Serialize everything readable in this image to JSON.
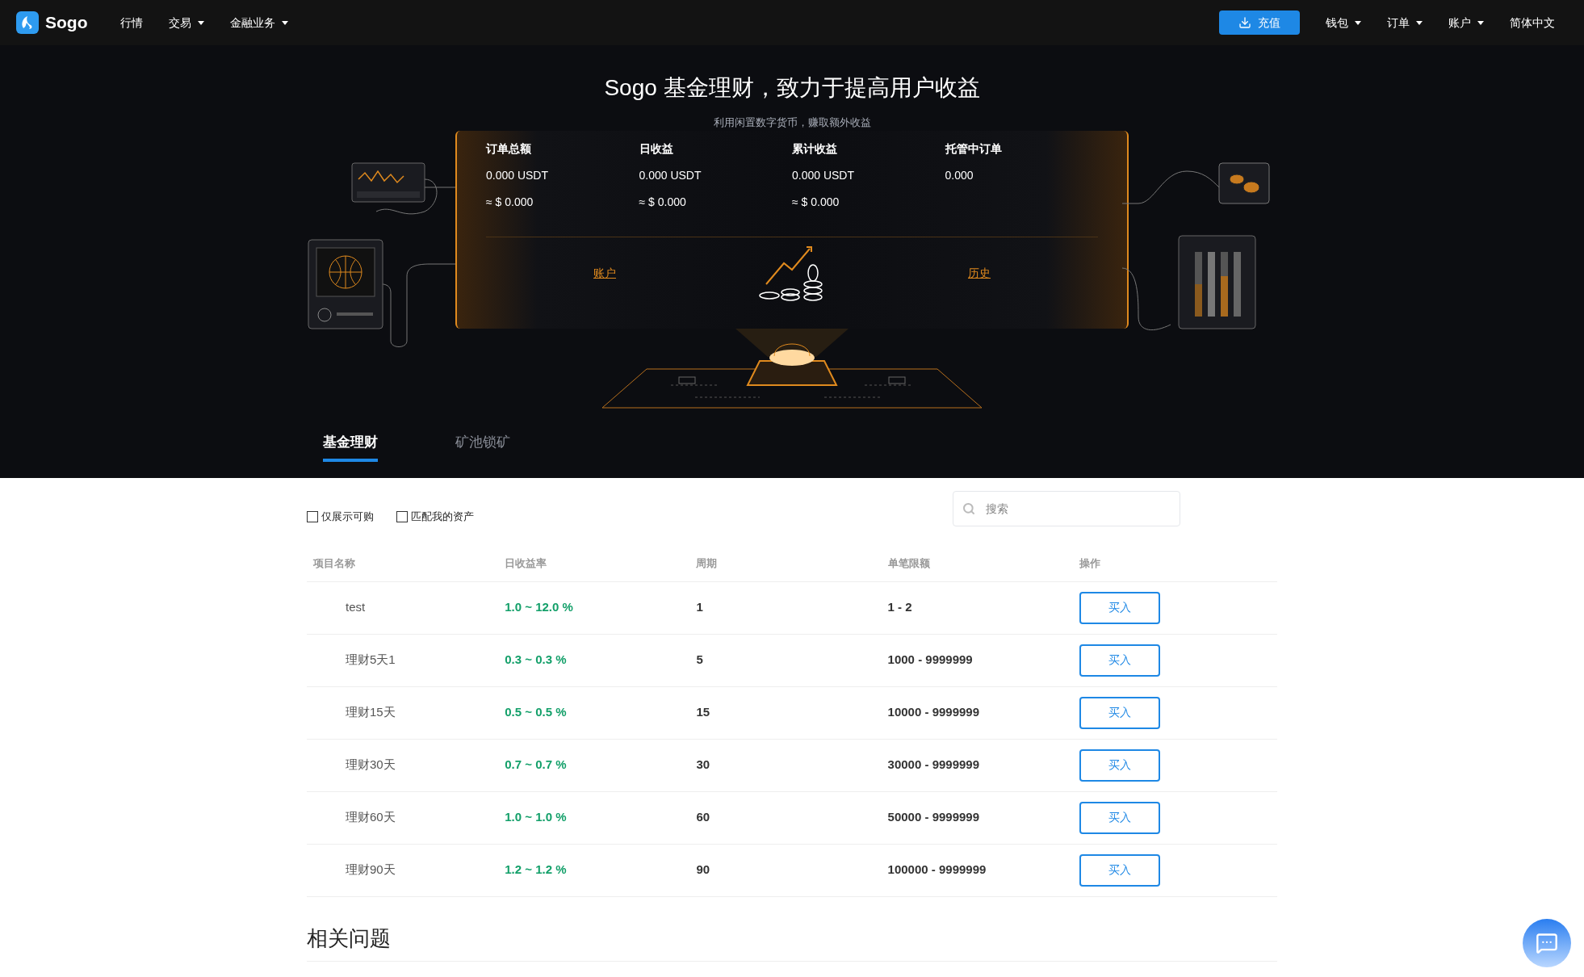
{
  "nav": {
    "brand": "Sogo",
    "items": [
      {
        "label": "行情",
        "dropdown": false
      },
      {
        "label": "交易",
        "dropdown": true
      },
      {
        "label": "金融业务",
        "dropdown": true
      }
    ],
    "deposit_button": "充值",
    "right_items": [
      {
        "label": "钱包",
        "dropdown": true
      },
      {
        "label": "订单",
        "dropdown": true
      },
      {
        "label": "账户",
        "dropdown": true
      },
      {
        "label": "简体中文",
        "dropdown": false
      }
    ]
  },
  "hero": {
    "title": "Sogo 基金理财，致力于提高用户收益",
    "subtitle": "利用闲置数字货币，赚取额外收益",
    "stats": [
      {
        "label": "订单总额",
        "value": "0.000 USDT",
        "approx": "≈ $ 0.000"
      },
      {
        "label": "日收益",
        "value": "0.000 USDT",
        "approx": "≈ $ 0.000"
      },
      {
        "label": "累计收益",
        "value": "0.000 USDT",
        "approx": "≈ $ 0.000"
      },
      {
        "label": "托管中订单",
        "value": "0.000"
      }
    ],
    "links": [
      "账户",
      "历史"
    ]
  },
  "tabs": [
    {
      "label": "基金理财",
      "selected": true
    },
    {
      "label": "矿池锁矿",
      "selected": false
    }
  ],
  "filters": [
    {
      "label": "仅展示可购",
      "checked": false
    },
    {
      "label": "匹配我的资产",
      "checked": false
    }
  ],
  "search": {
    "placeholder": "搜索"
  },
  "table": {
    "columns": [
      "项目名称",
      "日收益率",
      "周期",
      "单笔限额",
      "操作"
    ],
    "rows": [
      {
        "name": "test",
        "rate": "1.0 ~ 12.0 %",
        "period": "1",
        "limit": "1 - 2",
        "action": "买入"
      },
      {
        "name": "理财5天1",
        "rate": "0.3 ~ 0.3 %",
        "period": "5",
        "limit": "1000 - 9999999",
        "action": "买入"
      },
      {
        "name": "理财15天",
        "rate": "0.5 ~ 0.5 %",
        "period": "15",
        "limit": "10000 - 9999999",
        "action": "买入"
      },
      {
        "name": "理财30天",
        "rate": "0.7 ~ 0.7 %",
        "period": "30",
        "limit": "30000 - 9999999",
        "action": "买入"
      },
      {
        "name": "理财60天",
        "rate": "1.0 ~ 1.0 %",
        "period": "60",
        "limit": "50000 - 9999999",
        "action": "买入"
      },
      {
        "name": "理财90天",
        "rate": "1.2 ~ 1.2 %",
        "period": "90",
        "limit": "100000 - 9999999",
        "action": "买入"
      }
    ]
  },
  "faq": {
    "title": "相关问题"
  }
}
